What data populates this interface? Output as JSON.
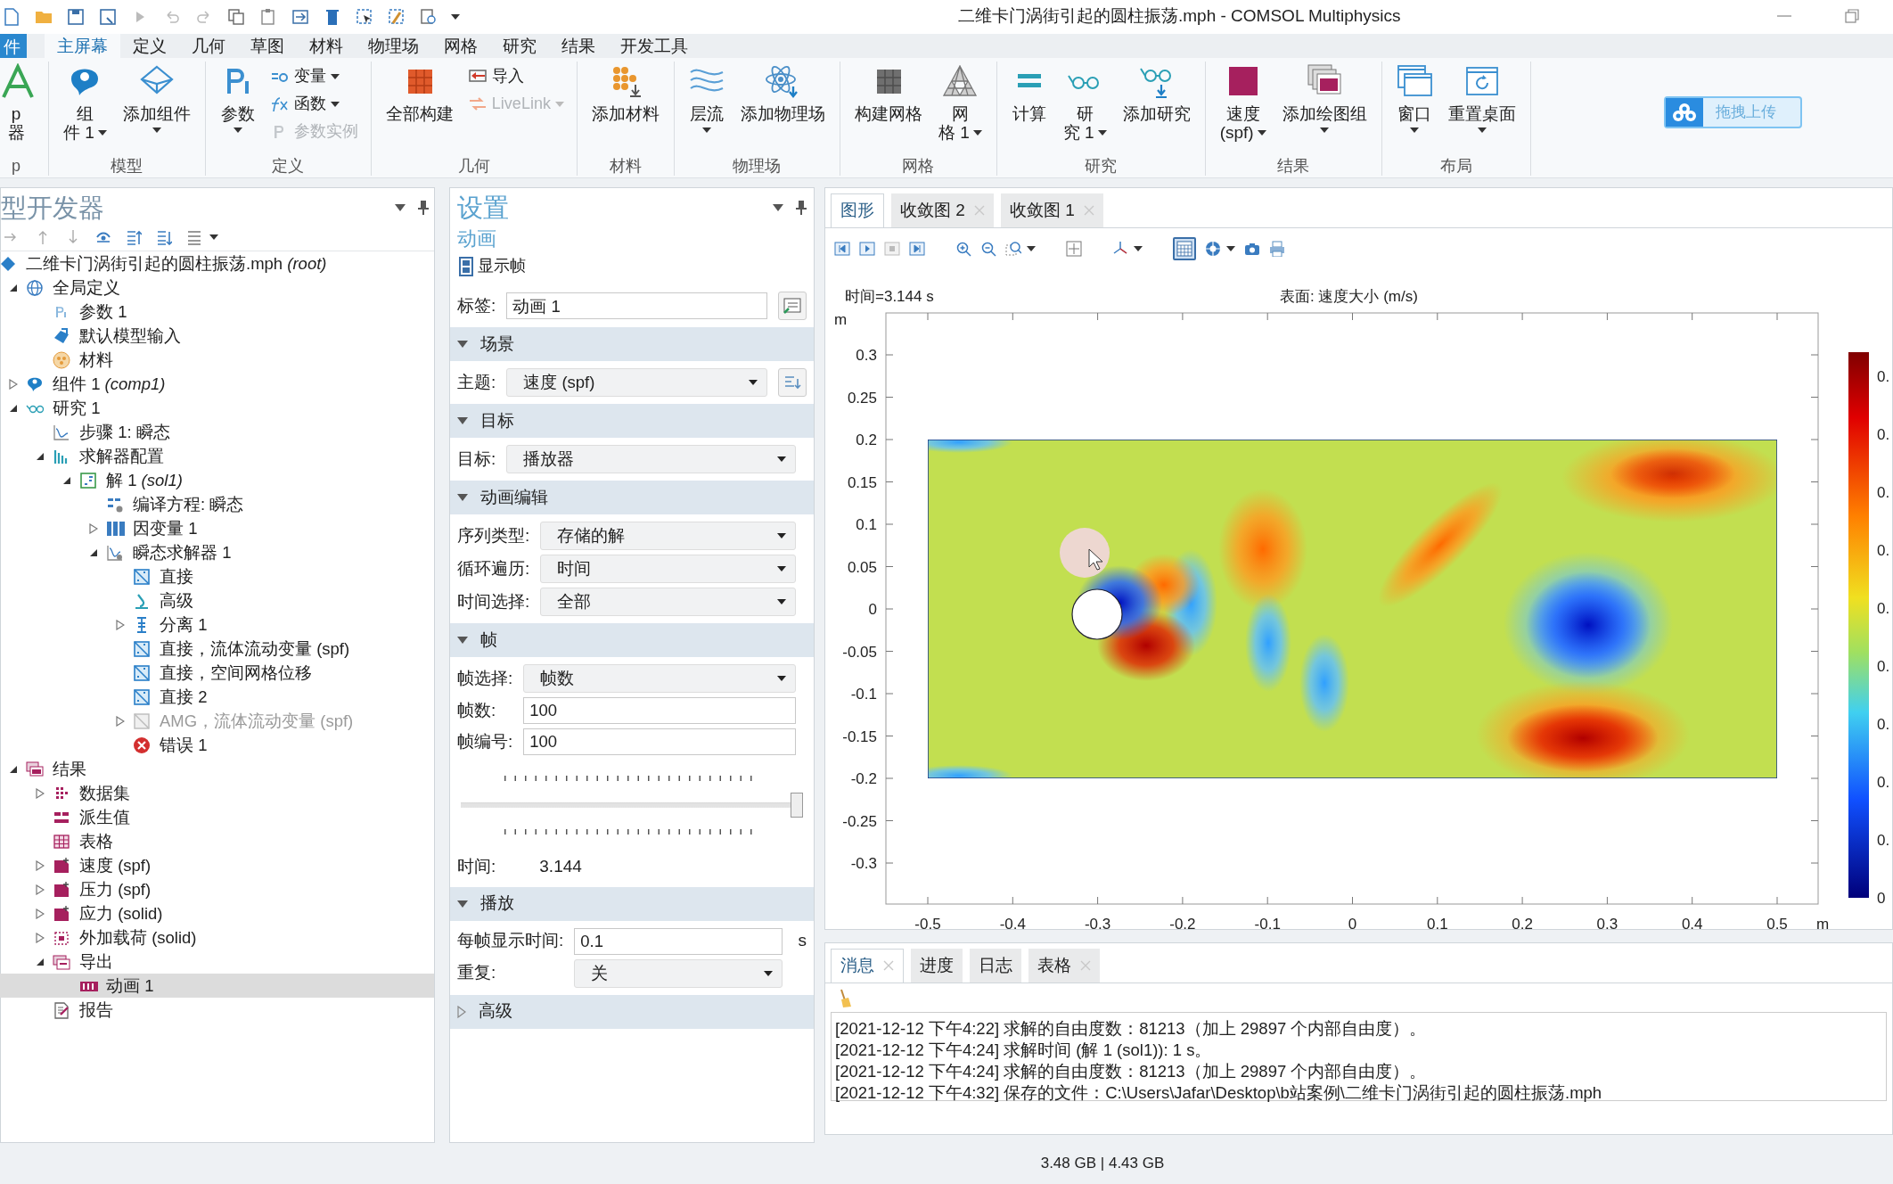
{
  "window": {
    "title": "二维卡门涡街引起的圆柱振荡.mph - COMSOL Multiphysics"
  },
  "ribbon": {
    "file_tab": {
      "label": "件"
    },
    "tabs": [
      {
        "label": "主屏幕",
        "selected": true
      },
      {
        "label": "定义",
        "selected": false
      },
      {
        "label": "几何",
        "selected": false
      },
      {
        "label": "草图",
        "selected": false
      },
      {
        "label": "材料",
        "selected": false
      },
      {
        "label": "物理场",
        "selected": false
      },
      {
        "label": "网格",
        "selected": false
      },
      {
        "label": "研究",
        "selected": false
      },
      {
        "label": "结果",
        "selected": false
      },
      {
        "label": "开发工具",
        "selected": false
      }
    ],
    "groups": [
      {
        "label": "p",
        "items": [
          {
            "kind": "large",
            "lines": [
              "p",
              "器"
            ],
            "menu": false,
            "disabled": false
          }
        ]
      },
      {
        "label": "模型",
        "items": [
          {
            "kind": "large",
            "lines": [
              "组",
              "件 1"
            ],
            "menu": true,
            "disabled": false
          },
          {
            "kind": "large",
            "lines": [
              "添加组件"
            ],
            "menu": true,
            "disabled": false
          }
        ]
      },
      {
        "label": "定义",
        "items": [
          {
            "kind": "large",
            "lines": [
              "参数"
            ],
            "menu": true,
            "disabled": false
          },
          {
            "kind": "small",
            "lines": [
              "变量"
            ],
            "menu": true,
            "disabled": false
          },
          {
            "kind": "small",
            "lines": [
              "函数"
            ],
            "menu": true,
            "disabled": false
          },
          {
            "kind": "small",
            "lines": [
              "参数实例"
            ],
            "menu": false,
            "disabled": true
          }
        ]
      },
      {
        "label": "几何",
        "items": [
          {
            "kind": "large",
            "lines": [
              "全部构建"
            ],
            "menu": false,
            "disabled": false
          },
          {
            "kind": "small",
            "lines": [
              "导入"
            ],
            "menu": false,
            "disabled": false
          },
          {
            "kind": "small",
            "lines": [
              "LiveLink"
            ],
            "menu": true,
            "disabled": true
          }
        ]
      },
      {
        "label": "材料",
        "items": [
          {
            "kind": "large",
            "lines": [
              "添加材料"
            ],
            "menu": false,
            "disabled": false
          }
        ]
      },
      {
        "label": "物理场",
        "items": [
          {
            "kind": "large",
            "lines": [
              "层流"
            ],
            "menu": true,
            "disabled": false
          },
          {
            "kind": "large",
            "lines": [
              "添加物理场"
            ],
            "menu": false,
            "disabled": false
          }
        ]
      },
      {
        "label": "网格",
        "items": [
          {
            "kind": "large",
            "lines": [
              "构建网格"
            ],
            "menu": false,
            "disabled": false
          },
          {
            "kind": "large",
            "lines": [
              "网",
              "格 1"
            ],
            "menu": true,
            "disabled": false
          }
        ]
      },
      {
        "label": "研究",
        "items": [
          {
            "kind": "large",
            "lines": [
              "计算"
            ],
            "menu": false,
            "disabled": false
          },
          {
            "kind": "large",
            "lines": [
              "研",
              "究 1"
            ],
            "menu": true,
            "disabled": false
          },
          {
            "kind": "large",
            "lines": [
              "添加研究"
            ],
            "menu": false,
            "disabled": false
          }
        ]
      },
      {
        "label": "结果",
        "items": [
          {
            "kind": "large",
            "lines": [
              "速度",
              "(spf)"
            ],
            "menu": true,
            "disabled": false
          },
          {
            "kind": "large",
            "lines": [
              "添加绘图组"
            ],
            "menu": true,
            "disabled": false
          }
        ]
      },
      {
        "label": "布局",
        "items": [
          {
            "kind": "large",
            "lines": [
              "窗口"
            ],
            "menu": true,
            "disabled": false
          },
          {
            "kind": "large",
            "lines": [
              "重置桌面"
            ],
            "menu": true,
            "disabled": false
          }
        ]
      }
    ]
  },
  "upload_button": {
    "label": "拖拽上传"
  },
  "model_builder": {
    "title": "型开发器",
    "tree": [
      {
        "label": "二维卡门涡街引起的圆柱振荡.mph *(root)*",
        "selected": false,
        "disabled": false,
        "children": [
          {
            "label": "全局定义",
            "expanded": true,
            "selected": false,
            "disabled": false,
            "children": [
              {
                "label": "参数 1",
                "selected": false,
                "disabled": false
              },
              {
                "label": "默认模型输入",
                "selected": false,
                "disabled": false
              },
              {
                "label": "材料",
                "selected": false,
                "disabled": false
              }
            ]
          },
          {
            "label": "组件 1 *(comp1)*",
            "expanded": false,
            "selected": false,
            "disabled": false
          },
          {
            "label": "研究 1",
            "expanded": true,
            "selected": false,
            "disabled": false,
            "children": [
              {
                "label": "步骤 1: 瞬态",
                "selected": false,
                "disabled": false
              },
              {
                "label": "求解器配置",
                "expanded": true,
                "selected": false,
                "disabled": false,
                "children": [
                  {
                    "label": "解 1 *(sol1)*",
                    "expanded": true,
                    "selected": false,
                    "disabled": false,
                    "children": [
                      {
                        "label": "编译方程: 瞬态",
                        "selected": false,
                        "disabled": false
                      },
                      {
                        "label": "因变量 1",
                        "expanded": false,
                        "selected": false,
                        "disabled": false
                      },
                      {
                        "label": "瞬态求解器 1",
                        "expanded": true,
                        "selected": false,
                        "disabled": false,
                        "children": [
                          {
                            "label": "直接",
                            "selected": false,
                            "disabled": false
                          },
                          {
                            "label": "高级",
                            "selected": false,
                            "disabled": false
                          },
                          {
                            "label": "分离 1",
                            "expanded": false,
                            "selected": false,
                            "disabled": false
                          },
                          {
                            "label": "直接，流体流动变量 (spf)",
                            "selected": false,
                            "disabled": false
                          },
                          {
                            "label": "直接，空间网格位移",
                            "selected": false,
                            "disabled": false
                          },
                          {
                            "label": "直接 2",
                            "selected": false,
                            "disabled": false
                          },
                          {
                            "label": "AMG，流体流动变量 (spf)",
                            "expanded": false,
                            "selected": false,
                            "disabled": true
                          },
                          {
                            "label": "错误 1",
                            "selected": false,
                            "disabled": false
                          }
                        ]
                      }
                    ]
                  }
                ]
              }
            ]
          },
          {
            "label": "结果",
            "expanded": true,
            "selected": false,
            "disabled": false,
            "children": [
              {
                "label": "数据集",
                "expanded": false,
                "selected": false,
                "disabled": false
              },
              {
                "label": "派生值",
                "selected": false,
                "disabled": false
              },
              {
                "label": "表格",
                "selected": false,
                "disabled": false
              },
              {
                "label": "速度 (spf)",
                "expanded": false,
                "selected": false,
                "disabled": false
              },
              {
                "label": "压力 (spf)",
                "expanded": false,
                "selected": false,
                "disabled": false
              },
              {
                "label": "应力 (solid)",
                "expanded": false,
                "selected": false,
                "disabled": false
              },
              {
                "label": "外加载荷 (solid)",
                "expanded": false,
                "selected": false,
                "disabled": false
              },
              {
                "label": "导出",
                "expanded": true,
                "selected": false,
                "disabled": false,
                "children": [
                  {
                    "label": "动画 1",
                    "selected": true,
                    "disabled": false
                  }
                ]
              },
              {
                "label": "报告",
                "selected": false,
                "disabled": false
              }
            ]
          }
        ]
      }
    ]
  },
  "settings": {
    "title": "设置",
    "subtitle": "动画",
    "toolbar_button": {
      "label": "显示帧"
    },
    "label_field": {
      "label": "标签:",
      "value": "动画 1"
    },
    "sections": [
      {
        "title": "场景",
        "expanded": true,
        "rows": [
          {
            "kind": "select",
            "label": "主题:",
            "value": "速度 (spf)",
            "side_button": true
          }
        ]
      },
      {
        "title": "目标",
        "expanded": true,
        "rows": [
          {
            "kind": "select",
            "label": "目标:",
            "value": "播放器"
          }
        ]
      },
      {
        "title": "动画编辑",
        "expanded": true,
        "rows": [
          {
            "kind": "select",
            "label": "序列类型:",
            "value": "存储的解"
          },
          {
            "kind": "select",
            "label": "循环遍历:",
            "value": "时间"
          },
          {
            "kind": "select",
            "label": "时间选择:",
            "value": "全部"
          }
        ]
      },
      {
        "title": "帧",
        "expanded": true,
        "rows": [
          {
            "kind": "select",
            "label": "帧选择:",
            "value": "帧数"
          },
          {
            "kind": "input",
            "label": "帧数:",
            "value": "100"
          },
          {
            "kind": "input",
            "label": "帧编号:",
            "value": "100"
          },
          {
            "kind": "slider",
            "level": 1.0
          },
          {
            "kind": "readout",
            "label": "时间:",
            "value": "3.144"
          }
        ]
      },
      {
        "title": "播放",
        "expanded": true,
        "rows": [
          {
            "kind": "input",
            "label": "每帧显示时间:",
            "value": "0.1",
            "unit": "s"
          },
          {
            "kind": "select",
            "label": "重复:",
            "value": "关"
          }
        ]
      },
      {
        "title": "高级",
        "expanded": false
      }
    ]
  },
  "graphics": {
    "tabs": [
      {
        "label": "图形",
        "selected": true,
        "closable": false
      },
      {
        "label": "收敛图 2",
        "selected": false,
        "closable": true
      },
      {
        "label": "收敛图 1",
        "selected": false,
        "closable": true
      }
    ],
    "grid_toggle_on": true,
    "plot": {
      "time_label": "时间=3.144 s",
      "surface_label": "表面: 速度大小 (m/s)",
      "y_unit": "m",
      "x_unit": "m",
      "y_tick_labels": [
        "0.3",
        "0.25",
        "0.2",
        "0.15",
        "0.1",
        "0.05",
        "0",
        "-0.05",
        "-0.1",
        "-0.15",
        "-0.2",
        "-0.25",
        "-0.3"
      ],
      "x_tick_labels": [
        "-0.5",
        "-0.4",
        "-0.3",
        "-0.2",
        "-0.1",
        "0",
        "0.1",
        "0.2",
        "0.3",
        "0.4",
        "0.5"
      ],
      "colorbar_labels": [
        "0.",
        "0.",
        "0.",
        "0.",
        "0.",
        "0.",
        "0.",
        "0.",
        "0.",
        "0"
      ]
    }
  },
  "messages": {
    "tabs": [
      {
        "label": "消息",
        "selected": true,
        "closable": true
      },
      {
        "label": "进度",
        "selected": false,
        "closable": false
      },
      {
        "label": "日志",
        "selected": false,
        "closable": false
      },
      {
        "label": "表格",
        "selected": false,
        "closable": true
      }
    ],
    "lines": [
      "[2021-12-12 下午4:22] 求解的自由度数：81213（加上 29897 个内部自由度）。",
      "[2021-12-12 下午4:24] 求解时间 (解 1 (sol1)): 1 s。",
      "[2021-12-12 下午4:24] 求解的自由度数：81213（加上 29897 个内部自由度）。",
      "[2021-12-12 下午4:32] 保存的文件：C:\\Users\\Jafar\\Desktop\\b站案例\\二维卡门涡街引起的圆柱振荡.mph"
    ]
  },
  "status_bar": {
    "memory": "3.48 GB | 4.43 GB"
  }
}
